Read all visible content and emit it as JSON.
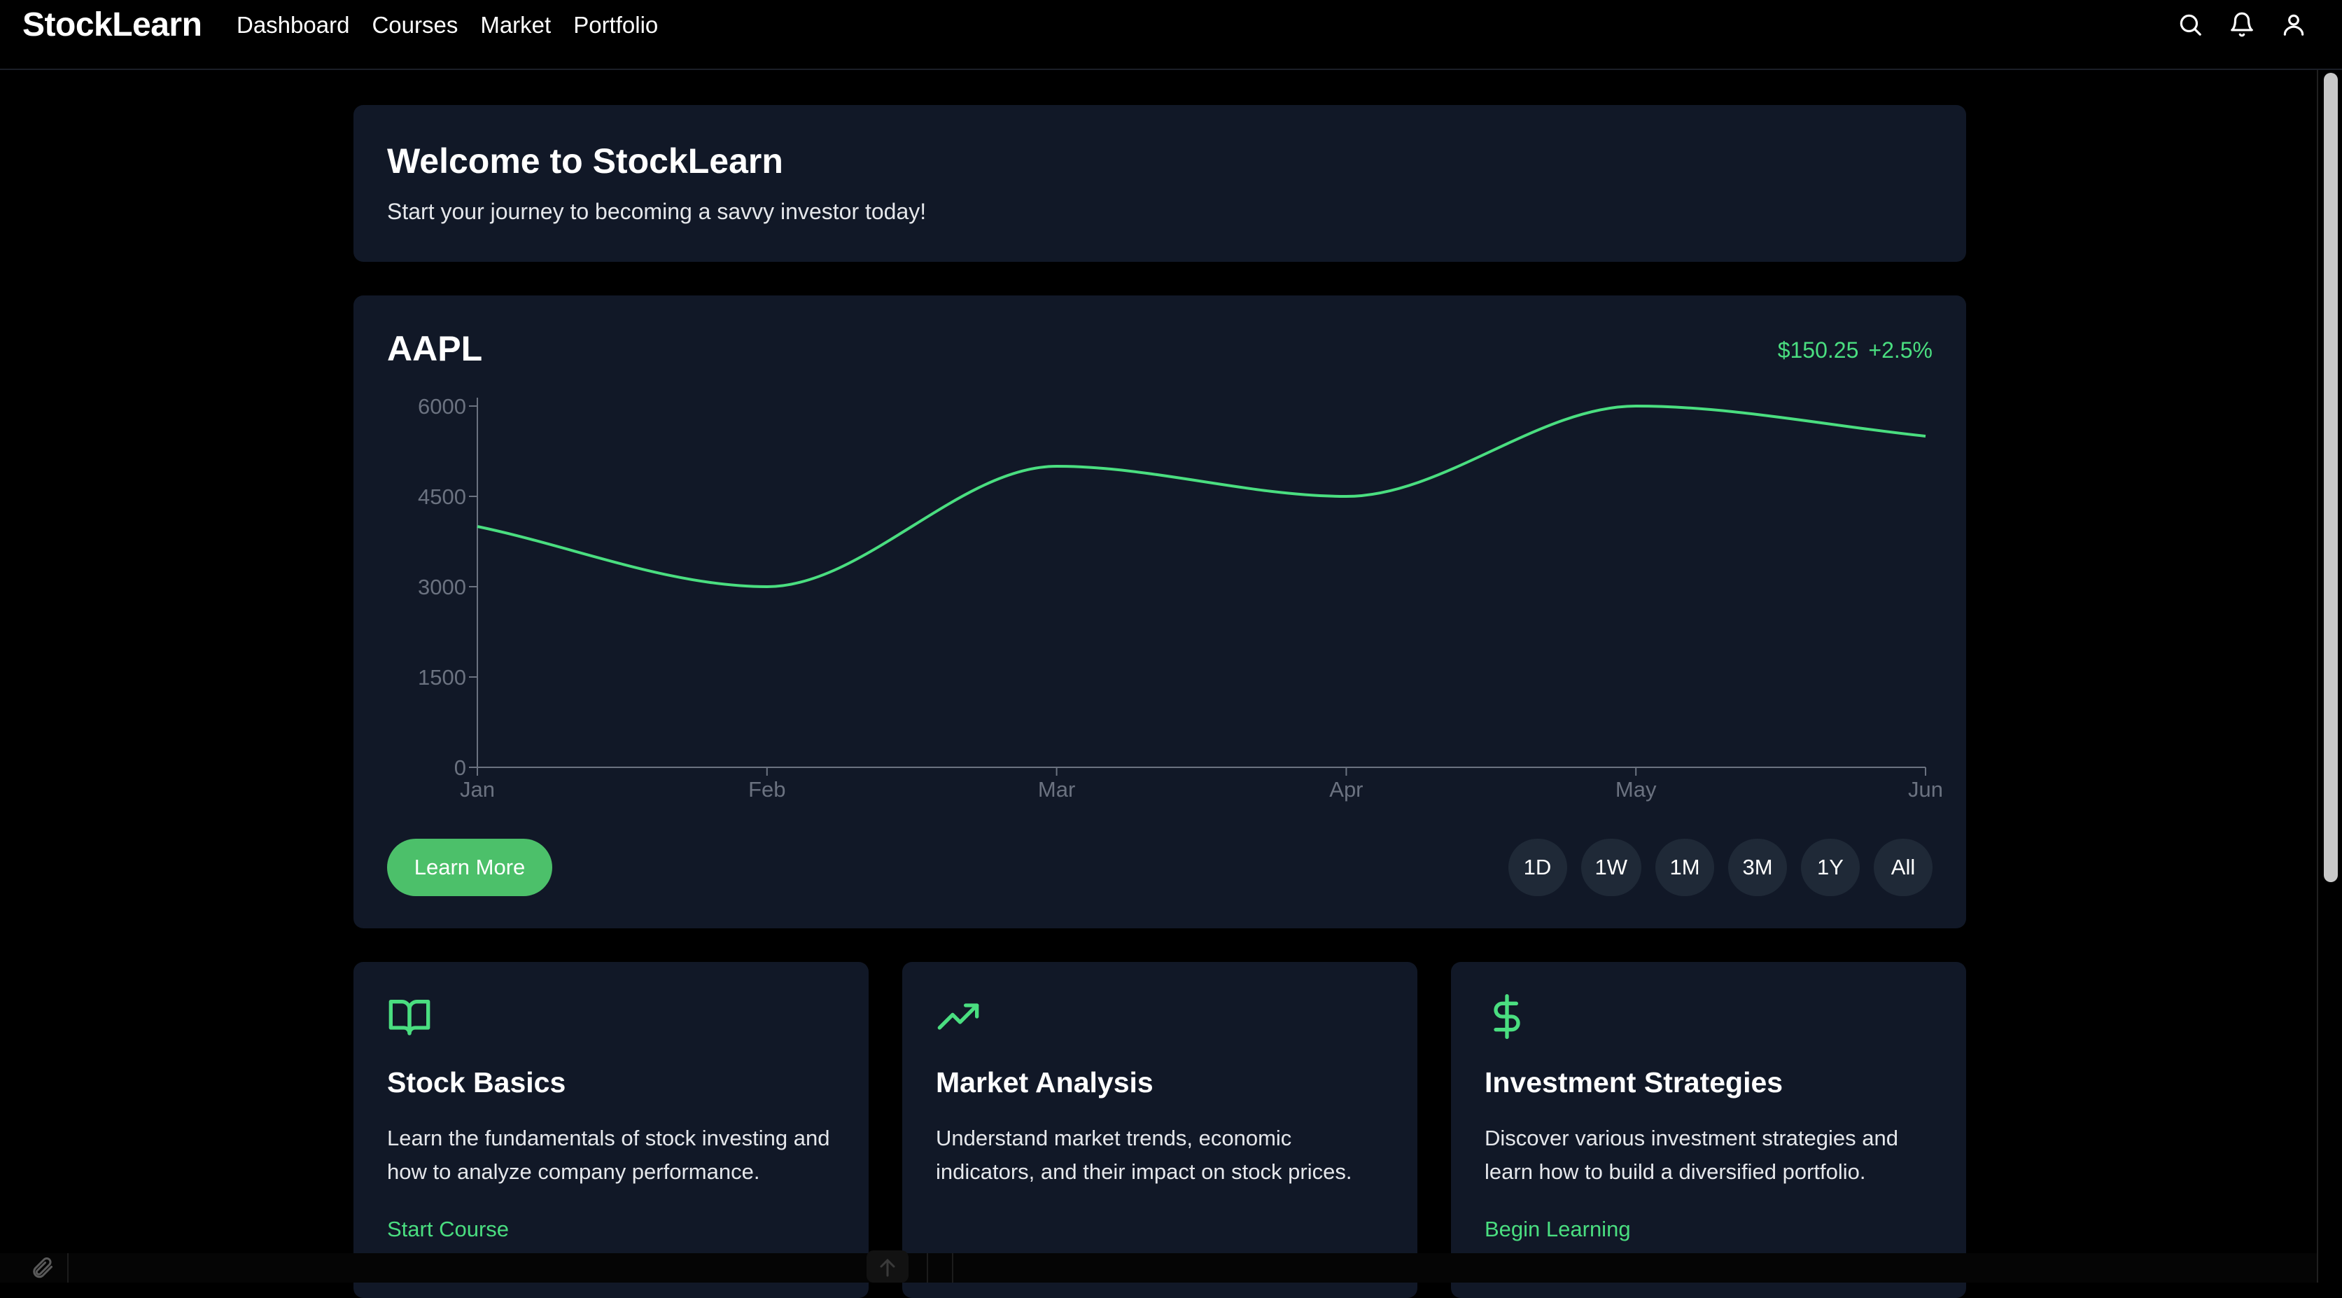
{
  "app": {
    "brand": "StockLearn",
    "nav": [
      "Dashboard",
      "Courses",
      "Market",
      "Portfolio"
    ],
    "icons": [
      "search-icon",
      "bell-icon",
      "user-icon"
    ]
  },
  "welcome": {
    "title": "Welcome to StockLearn",
    "subtitle": "Start your journey to becoming a savvy investor today!"
  },
  "stock": {
    "ticker": "AAPL",
    "price": "$150.25",
    "change": "+2.5%",
    "learn_more": "Learn More",
    "ranges": [
      "1D",
      "1W",
      "1M",
      "3M",
      "1Y",
      "All"
    ]
  },
  "chart_data": {
    "type": "line",
    "x": [
      "Jan",
      "Feb",
      "Mar",
      "Apr",
      "May",
      "Jun"
    ],
    "series": [
      {
        "values": [
          4000,
          3000,
          5000,
          4500,
          6000,
          5500
        ]
      }
    ],
    "yticks": [
      0,
      1500,
      3000,
      4500,
      6000
    ],
    "ylim": [
      0,
      6000
    ],
    "line_color": "#4ade80",
    "grid": false
  },
  "courses": [
    {
      "icon": "book-icon",
      "title": "Stock Basics",
      "description": "Learn the fundamentals of stock investing and how to analyze company performance.",
      "link": "Start Course"
    },
    {
      "icon": "trending-up-icon",
      "title": "Market Analysis",
      "description": "Understand market trends, economic indicators, and their impact on stock prices.",
      "link": ""
    },
    {
      "icon": "dollar-icon",
      "title": "Investment Strategies",
      "description": "Discover various investment strategies and learn how to build a diversified portfolio.",
      "link": "Begin Learning"
    }
  ],
  "colors": {
    "background": "#000000",
    "card": "#111827",
    "accent": "#4ade80",
    "button": "#4cc06a",
    "pill": "#1f2937"
  }
}
